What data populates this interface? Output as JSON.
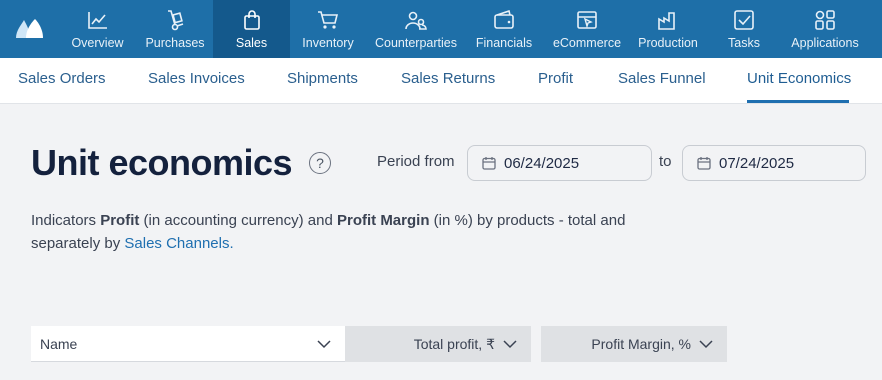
{
  "nav": {
    "items": [
      {
        "label": "Overview",
        "icon": "chart-line-icon"
      },
      {
        "label": "Purchases",
        "icon": "hand-truck-icon"
      },
      {
        "label": "Sales",
        "icon": "shopping-bag-icon"
      },
      {
        "label": "Inventory",
        "icon": "cart-icon"
      },
      {
        "label": "Counterparties",
        "icon": "users-icon"
      },
      {
        "label": "Financials",
        "icon": "wallet-icon"
      },
      {
        "label": "eCommerce",
        "icon": "storefront-icon"
      },
      {
        "label": "Production",
        "icon": "factory-icon"
      },
      {
        "label": "Tasks",
        "icon": "checkbox-icon"
      },
      {
        "label": "Applications",
        "icon": "apps-grid-icon"
      }
    ],
    "active": "Sales",
    "brand_color": "#1e6fa8"
  },
  "subnav": {
    "tabs": [
      "Sales Orders",
      "Sales Invoices",
      "Shipments",
      "Sales Returns",
      "Profit",
      "Sales Funnel",
      "Unit Economics"
    ],
    "active": "Unit Economics"
  },
  "page": {
    "title": "Unit economics",
    "help_symbol": "?",
    "period_from_label": "Period from",
    "date_from": "06/24/2025",
    "to_label": "to",
    "date_to": "07/24/2025",
    "description": {
      "part1": "Indicators ",
      "bold1": "Profit",
      "part2": " (in accounting currency) and ",
      "bold2": "Profit Margin",
      "part3": " (in %) by products - total and separately by ",
      "link": "Sales Channels."
    }
  },
  "table": {
    "columns": [
      "Name",
      "Total profit, ₹",
      "Profit Margin, %"
    ]
  }
}
